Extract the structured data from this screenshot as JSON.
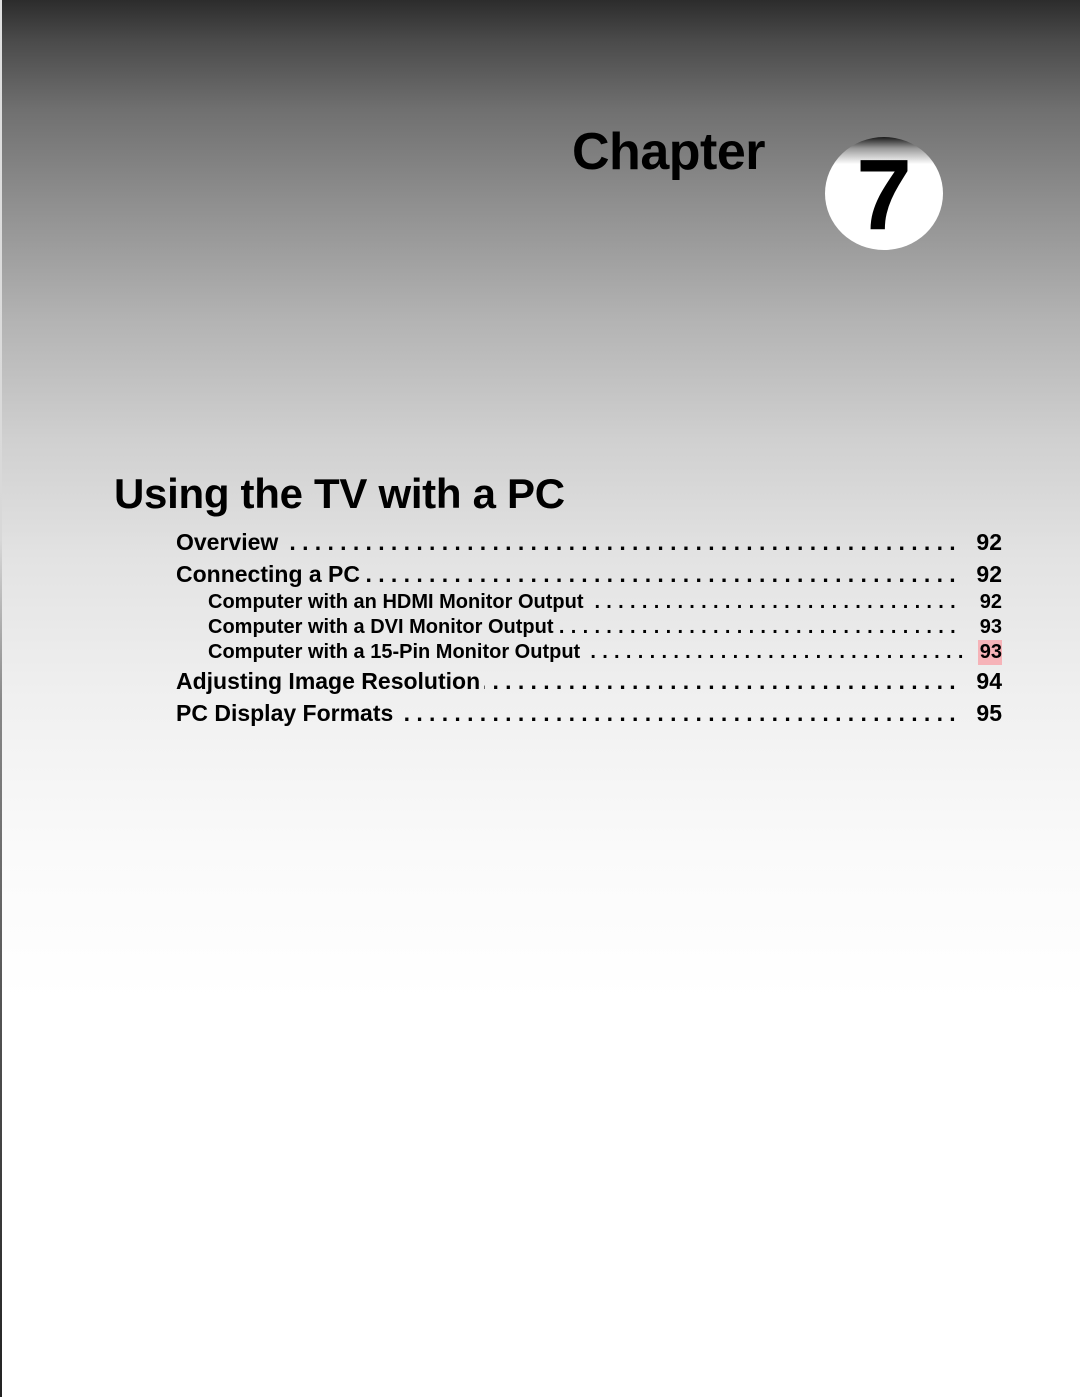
{
  "chapter": {
    "word": "Chapter",
    "number": "7"
  },
  "title": "Using the TV with a PC",
  "toc": [
    {
      "label": "Overview",
      "page": "92",
      "level": 1,
      "highlighted": false
    },
    {
      "label": "Connecting a PC",
      "page": "92",
      "level": 1,
      "highlighted": false
    },
    {
      "label": "Computer with an HDMI Monitor Output",
      "page": "92",
      "level": 2,
      "highlighted": false
    },
    {
      "label": "Computer with a DVI Monitor Output",
      "page": "93",
      "level": 2,
      "highlighted": false
    },
    {
      "label": "Computer with a 15-Pin Monitor Output",
      "page": "93",
      "level": 2,
      "highlighted": true
    },
    {
      "label": "Adjusting Image Resolution",
      "page": "94",
      "level": 1,
      "highlighted": false
    },
    {
      "label": "PC Display Formats",
      "page": "95",
      "level": 1,
      "highlighted": false
    }
  ],
  "colors": {
    "highlight": "#f6b3b8",
    "text": "#000000"
  }
}
